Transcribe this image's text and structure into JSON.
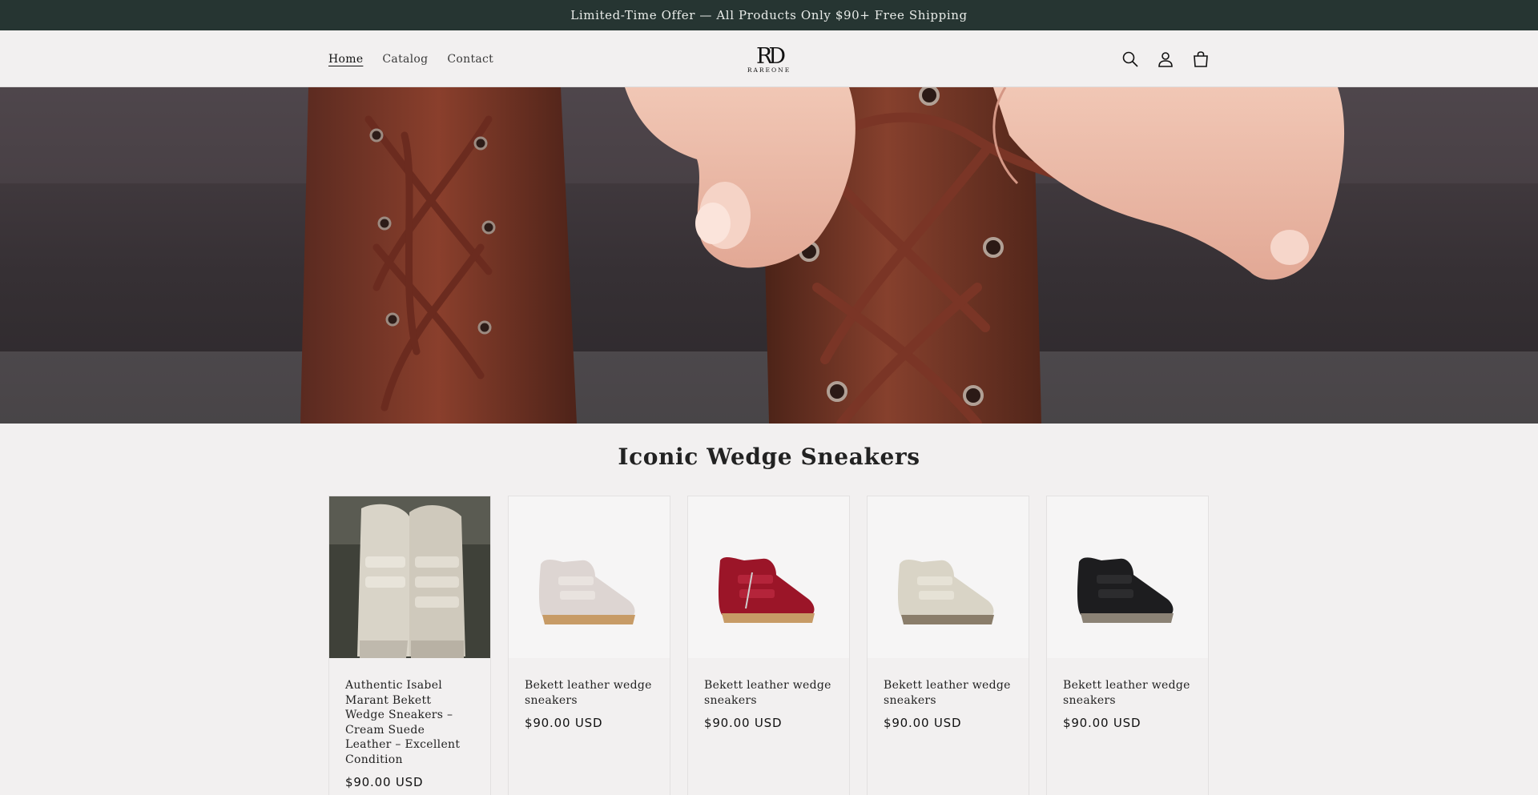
{
  "announcement": {
    "text": "Limited-Time Offer — All Products Only $90+ Free Shipping"
  },
  "header": {
    "nav": [
      {
        "label": "Home",
        "active": true
      },
      {
        "label": "Catalog",
        "active": false
      },
      {
        "label": "Contact",
        "active": false
      }
    ],
    "logo": {
      "mark": "RD",
      "wordmark": "RAREONE"
    },
    "icons": [
      "search-icon",
      "account-icon",
      "cart-icon"
    ]
  },
  "hero": {
    "image": "hands lacing brown leather boots"
  },
  "collection": {
    "title": "Iconic Wedge Sneakers",
    "products": [
      {
        "title": "Authentic Isabel Marant Bekett Wedge Sneakers – Cream Suede Leather – Excellent Condition",
        "price": "$90.00 USD",
        "color": "#d8d3c8",
        "photo": "real"
      },
      {
        "title": "Bekett leather wedge sneakers",
        "price": "$90.00 USD",
        "color": "#ddd5d2",
        "photo": "studio"
      },
      {
        "title": "Bekett leather wedge sneakers",
        "price": "$90.00 USD",
        "color": "#9b1528",
        "photo": "studio"
      },
      {
        "title": "Bekett leather wedge sneakers",
        "price": "$90.00 USD",
        "color": "#d9d4c6",
        "photo": "studio"
      },
      {
        "title": "Bekett leather wedge sneakers",
        "price": "$90.00 USD",
        "color": "#1d1d1f",
        "photo": "studio"
      }
    ]
  }
}
